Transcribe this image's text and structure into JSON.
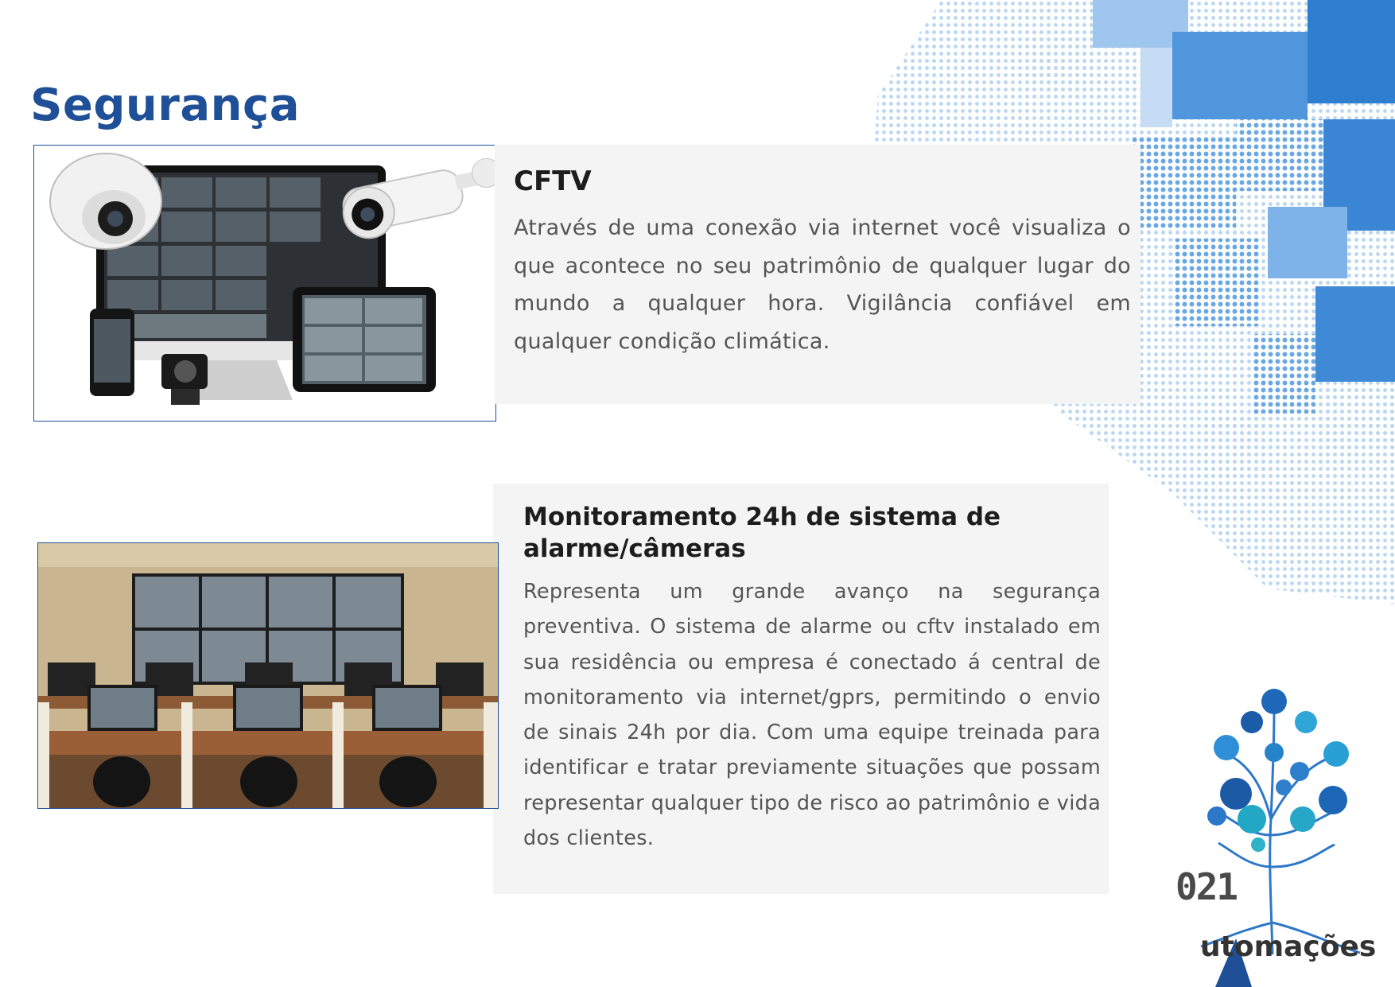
{
  "page": {
    "title": "Segurança"
  },
  "cftv": {
    "title": "CFTV",
    "body": "Através de uma conexão via internet você visualiza o que acontece no seu patrimônio de qualquer lugar do mundo a qualquer hora. Vigilância confiável em qualquer condição climática."
  },
  "monitoring": {
    "title": "Monitoramento 24h de sistema de alarme/câmeras",
    "body": "Representa um grande avanço na segurança preventiva. O sistema de alarme ou cftv instalado em sua residência ou empresa é conectado á central de monitoramento via internet/gprs, permitindo o envio de sinais 24h por dia. Com uma equipe treinada para identificar e tratar previamente situações que possam representar qualquer tipo de risco ao patrimônio e vida dos clientes."
  },
  "logo": {
    "number": "021",
    "word": "utomações"
  },
  "colors": {
    "title_blue": "#1f4f96",
    "pattern_blue": "#3f8ad6",
    "card_bg": "#f4f4f4"
  }
}
